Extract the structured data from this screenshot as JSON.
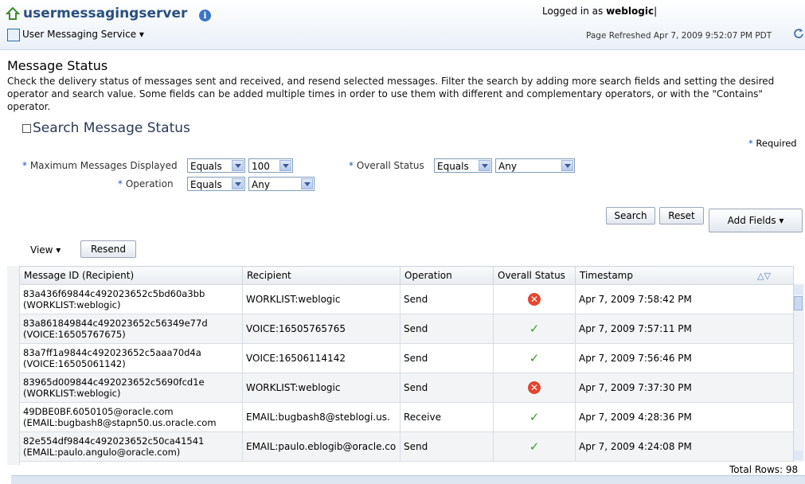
{
  "header": {
    "app_title": "usermessagingserver",
    "target_menu": "User Messaging Service ▾",
    "login_prefix": "Logged in as",
    "login_user": "weblogic",
    "refresh": "Page Refreshed Apr 7, 2009 9:52:07 PM PDT"
  },
  "page": {
    "title": "Message Status",
    "description": "Check the delivery status of messages sent and received, and resend selected messages. Filter the search by adding more search fields and setting the desired operator and search value. Some fields can be added multiple times in order to use them with different and complementary operators, or with the \"Contains\" operator."
  },
  "search": {
    "header": "Search Message Status",
    "required_note": "Required",
    "fields": {
      "max_label": "Maximum Messages Displayed",
      "max_operator": "Equals",
      "max_value": "100",
      "status_label": "Overall Status",
      "status_operator": "Equals",
      "status_value": "Any",
      "operation_label": "Operation",
      "operation_operator": "Equals",
      "operation_value": "Any"
    },
    "search_button": "Search",
    "reset_button": "Reset",
    "add_fields_button": "Add Fields"
  },
  "table": {
    "view_menu": "View ▾",
    "resend_button": "Resend",
    "columns": [
      "Message ID (Recipient)",
      "Recipient",
      "Operation",
      "Overall Status",
      "Timestamp"
    ],
    "rows": [
      {
        "id1": "83a436f69844c492023652c5bd60a3bb",
        "id2": "(WORKLIST:weblogic)",
        "recipient": "WORKLIST:weblogic",
        "operation": "Send",
        "status": "error",
        "timestamp": "Apr 7, 2009 7:58:42 PM"
      },
      {
        "id1": "83a861849844c492023652c56349e77d",
        "id2": "(VOICE:16505767675)",
        "recipient": "VOICE:16505765765",
        "operation": "Send",
        "status": "success",
        "timestamp": "Apr 7, 2009 7:57:11 PM"
      },
      {
        "id1": "83a7ff1a9844c492023652c5aaa70d4a",
        "id2": "(VOICE:16505061142)",
        "recipient": "VOICE:16506114142",
        "operation": "Send",
        "status": "success",
        "timestamp": "Apr 7, 2009 7:56:46 PM"
      },
      {
        "id1": "83965d009844c492023652c5690fcd1e",
        "id2": "(WORKLIST:weblogic)",
        "recipient": "WORKLIST:weblogic",
        "operation": "Send",
        "status": "error",
        "timestamp": "Apr 7, 2009 7:37:30 PM"
      },
      {
        "id1": "49DBE0BF.6050105@oracle.com",
        "id2": "(EMAIL:bugbash8@stapn50.us.oracle.com",
        "recipient": "EMAIL:bugbash8@steblogi.us.",
        "operation": "Receive",
        "status": "success",
        "timestamp": "Apr 7, 2009 4:28:36 PM"
      },
      {
        "id1": "82e554df9844c492023652c50ca41541",
        "id2": "(EMAIL:paulo.angulo@oracle.com)",
        "recipient": "EMAIL:paulo.eblogib@oracle.co",
        "operation": "Send",
        "status": "success",
        "timestamp": "Apr 7, 2009 4:24:08 PM"
      }
    ],
    "total_rows": "Total Rows: 98"
  },
  "colors": {
    "accent": "#2a4f80",
    "success": "#3a9b2a",
    "error": "#e2462f"
  }
}
